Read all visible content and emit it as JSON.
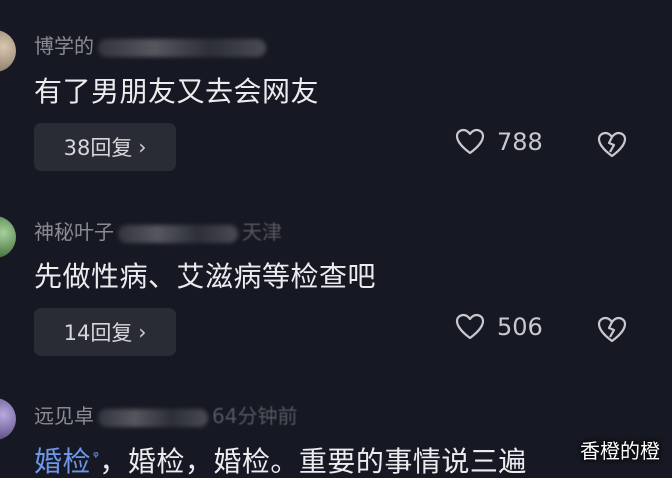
{
  "comments": [
    {
      "username": "博学的",
      "text": "有了男朋友又去会网友",
      "reply_label": "38回复",
      "likes": "788"
    },
    {
      "username": "神秘叶子",
      "meta_tail": "天津",
      "text": "先做性病、艾滋病等检查吧",
      "reply_label": "14回复",
      "likes": "506"
    },
    {
      "username": "远见卓",
      "meta_tail": "64分钟前",
      "text_link": "婚检",
      "text": "，婚检，婚检。重要的事情说三遍"
    }
  ],
  "watermark": "香橙的橙",
  "colors": {
    "background": "#161823",
    "link": "#6c97e6",
    "button": "#2a2c35"
  },
  "icons": [
    "heart-outline-icon",
    "broken-heart-icon",
    "chevron-right-icon",
    "search-hint-icon"
  ]
}
